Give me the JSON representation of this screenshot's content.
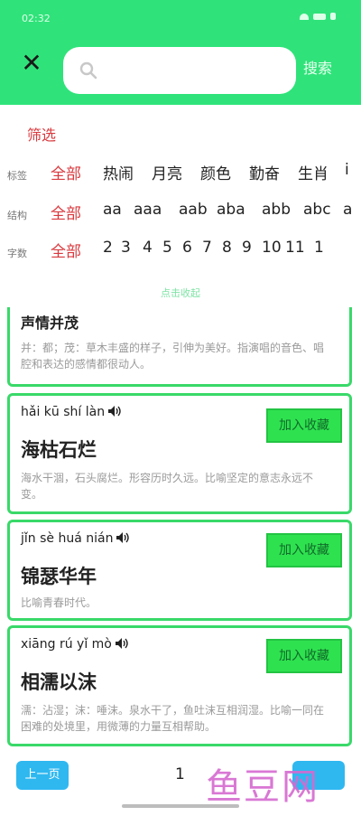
{
  "status_bar": {
    "time": "02:32"
  },
  "header": {
    "search_placeholder": "",
    "search_button": "搜索"
  },
  "filters": {
    "title": "筛选",
    "rows": [
      {
        "label": "标签",
        "options": [
          "全部",
          "热闹",
          "月亮",
          "颜色",
          "勤奋",
          "生肖",
          "i"
        ],
        "selected": 0
      },
      {
        "label": "结构",
        "options": [
          "全部",
          "aa",
          "aaa",
          "aab",
          "aba",
          "abb",
          "abc",
          "a"
        ],
        "selected": 0
      },
      {
        "label": "字数",
        "options": [
          "全部",
          "2",
          "3",
          "4",
          "5",
          "6",
          "7",
          "8",
          "9",
          "10",
          "11",
          "1"
        ],
        "selected": 0
      }
    ],
    "collapse_label": "点击收起"
  },
  "results": [
    {
      "pinyin": "",
      "word": "声情并茂",
      "description": "并：都；茂：草木丰盛的样子，引伸为美好。指演唱的音色、唱腔和表达的感情都很动人。",
      "favorite_label": ""
    },
    {
      "pinyin": "hǎi kū shí làn",
      "word": "海枯石烂",
      "description": "海水干涸，石头腐烂。形容历时久远。比喻坚定的意志永远不变。",
      "favorite_label": "加入收藏"
    },
    {
      "pinyin": "jǐn sè huá nián",
      "word": "锦瑟华年",
      "description": "比喻青春时代。",
      "favorite_label": "加入收藏"
    },
    {
      "pinyin": "xiāng rú yǐ mò",
      "word": "相濡以沫",
      "description": "濡：沾湿；沫：唾沫。泉水干了，鱼吐沫互相润湿。比喻一同在困难的处境里，用微薄的力量互相帮助。",
      "favorite_label": "加入收藏"
    }
  ],
  "pagination": {
    "prev_label": "上一页",
    "current_page": "1"
  },
  "watermark": "鱼豆网",
  "colors": {
    "header": "#2fe37a",
    "card_border": "#39d969",
    "selected_filter": "#d9393e",
    "button_blue": "#2fb8f0"
  }
}
